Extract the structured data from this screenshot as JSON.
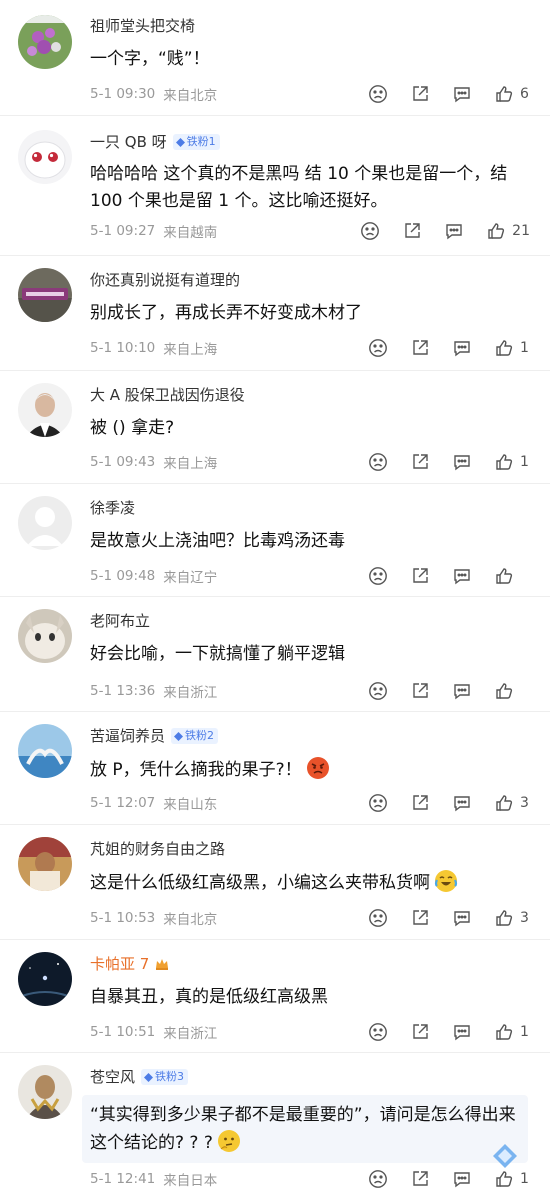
{
  "comments": [
    {
      "name": "祖师堂头把交椅",
      "badge": "",
      "text": "一个字，“贱”！",
      "time": "5-1 09:30",
      "loc": "来自北京",
      "likes": "6"
    },
    {
      "name": "一只 QB 呀",
      "badge": "铁粉1",
      "text": "哈哈哈哈  这个真的不是黑吗 结 10 个果也是留一个，结 100 个果也是留 1 个。这比喻还挺好。",
      "time": "5-1 09:27",
      "loc": "来自越南",
      "likes": "21"
    },
    {
      "name": "你还真别说挺有道理的",
      "badge": "",
      "text": "别成长了，再成长弄不好变成木材了",
      "time": "5-1 10:10",
      "loc": "来自上海",
      "likes": "1"
    },
    {
      "name": "大 A 股保卫战因伤退役",
      "badge": "",
      "text": "被 () 拿走?",
      "time": "5-1 09:43",
      "loc": "来自上海",
      "likes": "1"
    },
    {
      "name": "徐季凌",
      "badge": "",
      "text": "是故意火上浇油吧？比毒鸡汤还毒",
      "time": "5-1 09:48",
      "loc": "来自辽宁",
      "likes": ""
    },
    {
      "name": "老阿布立",
      "badge": "",
      "text": "好会比喻，一下就搞懂了躺平逻辑",
      "time": "5-1 13:36",
      "loc": "来自浙江",
      "likes": ""
    },
    {
      "name": "苦逼饲养员",
      "badge": "铁粉2",
      "text": "放 P，凭什么摘我的果子?！",
      "time": "5-1 12:07",
      "loc": "来自山东",
      "likes": "3"
    },
    {
      "name": "芃姐的财务自由之路",
      "badge": "",
      "text": "这是什么低级红高级黑，小编这么夹带私货啊",
      "time": "5-1 10:53",
      "loc": "来自北京",
      "likes": "3"
    },
    {
      "name": "卡帕亚 7",
      "badge": "",
      "text": "自暴其丑，真的是低级红高级黑",
      "time": "5-1 10:51",
      "loc": "来自浙江",
      "likes": "1"
    },
    {
      "name": "苍空风",
      "badge": "铁粉3",
      "text": "“其实得到多少果子都不是最重要的”，请问是怎么得出来这个结论的? ? ?",
      "time": "5-1 12:41",
      "loc": "来自日本",
      "likes": "1"
    }
  ],
  "icons": {
    "dislike": "frown-icon",
    "share": "share-icon",
    "comment": "comment-icon",
    "like": "thumbs-up-icon"
  },
  "colors": {
    "badge_bg": "#eaf2ff",
    "badge_text": "#4d7ce6",
    "vip_name": "#e8702a",
    "meta": "#999999"
  }
}
